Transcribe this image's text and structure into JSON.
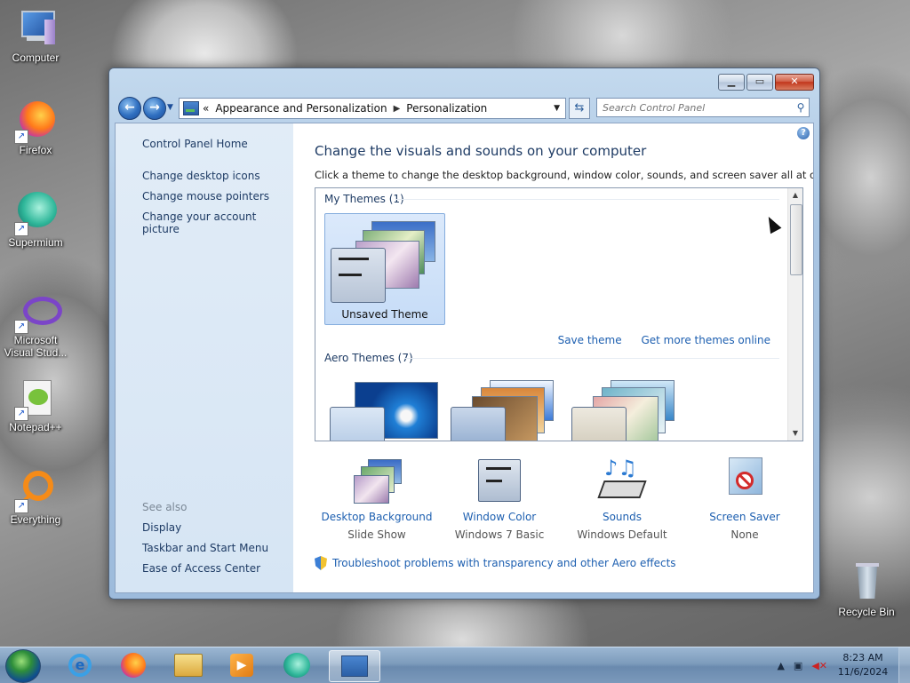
{
  "desktop": {
    "icons": [
      {
        "label": "Computer"
      },
      {
        "label": "Firefox"
      },
      {
        "label": "Supermium"
      },
      {
        "label": "Microsoft Visual Stud..."
      },
      {
        "label": "Notepad++"
      },
      {
        "label": "Everything"
      },
      {
        "label": "Recycle Bin"
      }
    ]
  },
  "window": {
    "address": {
      "chevron": "«",
      "crumbs": [
        "Appearance and Personalization",
        "Personalization"
      ]
    },
    "search": {
      "placeholder": "Search Control Panel"
    },
    "left_pane": {
      "home": "Control Panel Home",
      "tasks": [
        "Change desktop icons",
        "Change mouse pointers",
        "Change your account picture"
      ],
      "see_also_title": "See also",
      "see_also": [
        "Display",
        "Taskbar and Start Menu",
        "Ease of Access Center"
      ]
    },
    "main": {
      "heading": "Change the visuals and sounds on your computer",
      "subtext": "Click a theme to change the desktop background, window color, sounds, and screen saver all at once.",
      "my_themes_title": "My Themes (1)",
      "my_themes": [
        {
          "label": "Unsaved Theme",
          "selected": true
        }
      ],
      "save_theme": "Save theme",
      "get_more": "Get more themes online",
      "aero_title": "Aero Themes (7)",
      "settings": [
        {
          "title": "Desktop Background",
          "value": "Slide Show",
          "icon": "desktop-background-icon"
        },
        {
          "title": "Window Color",
          "value": "Windows 7 Basic",
          "icon": "window-color-icon"
        },
        {
          "title": "Sounds",
          "value": "Windows Default",
          "icon": "sounds-icon"
        },
        {
          "title": "Screen Saver",
          "value": "None",
          "icon": "screen-saver-icon"
        }
      ],
      "troubleshoot": "Troubleshoot problems with transparency and other Aero effects"
    }
  },
  "taskbar": {
    "pinned": [
      "internet-explorer-icon",
      "firefox-icon",
      "file-explorer-icon",
      "media-player-icon",
      "supermium-icon",
      "control-panel-icon"
    ],
    "clock_time": "8:23 AM",
    "clock_date": "11/6/2024"
  },
  "colors": {
    "link": "#1d5fb0",
    "heading": "#1e3b64",
    "selected_theme": "#c6dcf7"
  }
}
